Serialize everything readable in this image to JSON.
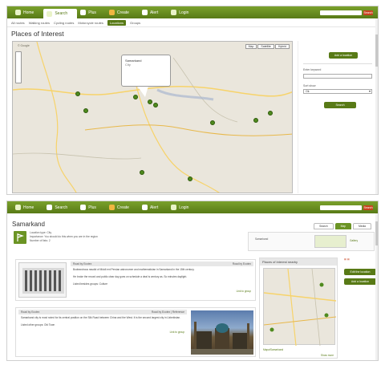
{
  "nav": {
    "items": [
      {
        "label": "Home"
      },
      {
        "label": "Search"
      },
      {
        "label": "Plus"
      },
      {
        "label": "Create"
      },
      {
        "label": "Alert"
      },
      {
        "label": "Login"
      }
    ],
    "search_button": "Search"
  },
  "shot1": {
    "subnav": [
      "All routes",
      "Walking routes",
      "Cycling routes",
      "Motorcycle routes",
      "Locations",
      "Groups"
    ],
    "active_subnav": "Locations",
    "title": "Places of Interest",
    "map_types": [
      "Map",
      "Satellite",
      "Hybrid"
    ],
    "bubble_title": "Samarkand",
    "bubble_text": "City",
    "side": {
      "add_button": "Add a location",
      "keyword_label": "Enter keyword",
      "sort_label": "Sort show",
      "sort_value": "Ok",
      "search_button": "Search"
    }
  },
  "shot2": {
    "title": "Samarkand",
    "meta": [
      "Location type: City",
      "Importance: You should do this when you are in the region",
      "Number of lists: 2"
    ],
    "tabs": [
      "Search",
      "Map",
      "Media"
    ],
    "active_tab": "Map",
    "promo_text": "Samarkand",
    "promo_link": "Gallery",
    "nearby_title": "Places of interest nearby",
    "nearby_buttons": [
      "Edit the location",
      "Add a location"
    ],
    "nearby_link": "Mapa/Samarkand",
    "nearby_more": "Show more",
    "card1": {
      "head_left": "Road by Ecotex",
      "head_right": "Road by Ecotex",
      "text": "Bodeandrous rawdid of Middl ent Persian astronomer and mathematician in Samarkand in the 15th century.",
      "text2": "He broke the record and public clear day goes on schedule a deal is century as. So minutes daylight.",
      "link": "Listed besides groups: Culture",
      "more": "Link to group"
    },
    "card2": {
      "head_left": "Road by Ecotex",
      "head_right": "Road by Ecotex | Reference",
      "text": "Samarkand city is most noted for its central position on the Silk Road between China and the West. It is the second largest city in Uzbekistan.",
      "link": "Listed other groups: Old Town",
      "more": "Link to group"
    }
  }
}
